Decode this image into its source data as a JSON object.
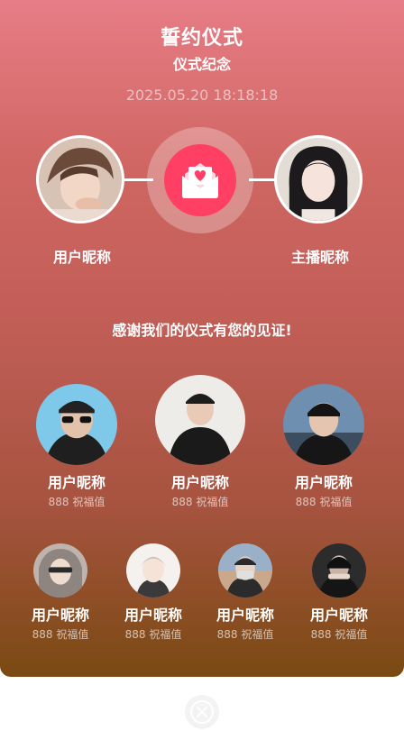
{
  "header": {
    "title": "誓约仪式",
    "subtitle": "仪式纪念",
    "timestamp": "2025.05.20 18:18:18"
  },
  "couple": {
    "left_name": "用户昵称",
    "right_name": "主播昵称"
  },
  "thanks_text": "感谢我们的仪式有您的见证!",
  "guests_row1": [
    {
      "name": "用户昵称",
      "value": "888 祝福值"
    },
    {
      "name": "用户昵称",
      "value": "888 祝福值"
    },
    {
      "name": "用户昵称",
      "value": "888 祝福值"
    }
  ],
  "guests_row2": [
    {
      "name": "用户昵称",
      "value": "888 祝福值"
    },
    {
      "name": "用户昵称",
      "value": "888 祝福值"
    },
    {
      "name": "用户昵称",
      "value": "888 祝福值"
    },
    {
      "name": "用户昵称",
      "value": "888 祝福值"
    }
  ],
  "icons": {
    "center": "heart-envelope-icon",
    "close": "close-icon"
  },
  "colors": {
    "accent": "#ff3f63",
    "gradient_top": "#e77d86",
    "gradient_bottom": "#7a4a12"
  }
}
